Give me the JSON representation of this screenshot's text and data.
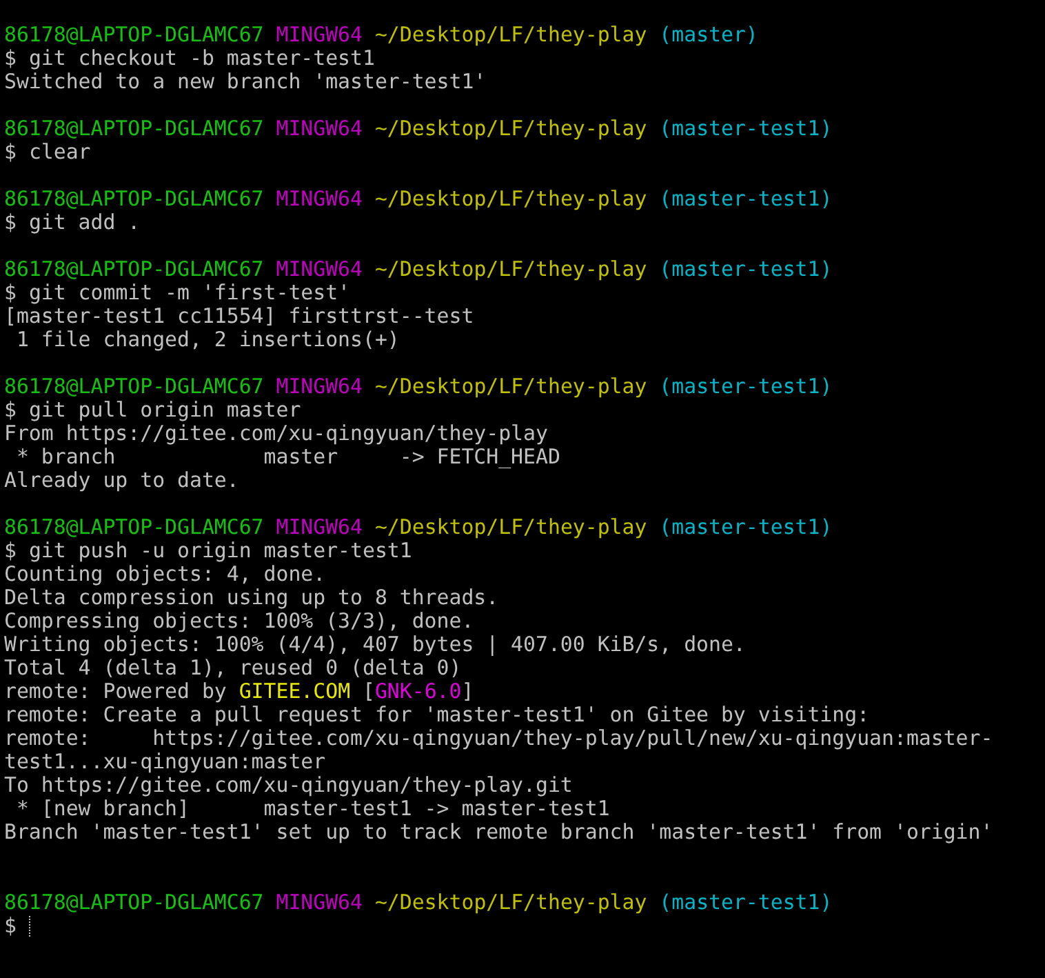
{
  "terminal": {
    "lines": [
      {
        "kind": "prompt",
        "user": "86178@LAPTOP-DGLAMC67",
        "system": "MINGW64",
        "path": "~/Desktop/LF/they-play",
        "branch": "(master)"
      },
      {
        "kind": "command",
        "sign": "$",
        "text": "git checkout -b master-test1"
      },
      {
        "kind": "output",
        "parts": [
          {
            "text": "Switched to a new branch 'master-test1'"
          }
        ]
      },
      {
        "kind": "blank"
      },
      {
        "kind": "prompt",
        "user": "86178@LAPTOP-DGLAMC67",
        "system": "MINGW64",
        "path": "~/Desktop/LF/they-play",
        "branch": "(master-test1)"
      },
      {
        "kind": "command",
        "sign": "$",
        "text": "clear"
      },
      {
        "kind": "blank"
      },
      {
        "kind": "prompt",
        "user": "86178@LAPTOP-DGLAMC67",
        "system": "MINGW64",
        "path": "~/Desktop/LF/they-play",
        "branch": "(master-test1)"
      },
      {
        "kind": "command",
        "sign": "$",
        "text": "git add ."
      },
      {
        "kind": "blank"
      },
      {
        "kind": "prompt",
        "user": "86178@LAPTOP-DGLAMC67",
        "system": "MINGW64",
        "path": "~/Desktop/LF/they-play",
        "branch": "(master-test1)"
      },
      {
        "kind": "command",
        "sign": "$",
        "text": "git commit -m 'first-test'"
      },
      {
        "kind": "output",
        "parts": [
          {
            "text": "[master-test1 cc11554] firsttrst--test"
          }
        ]
      },
      {
        "kind": "output",
        "parts": [
          {
            "text": " 1 file changed, 2 insertions(+)"
          }
        ]
      },
      {
        "kind": "blank"
      },
      {
        "kind": "prompt",
        "user": "86178@LAPTOP-DGLAMC67",
        "system": "MINGW64",
        "path": "~/Desktop/LF/they-play",
        "branch": "(master-test1)"
      },
      {
        "kind": "command",
        "sign": "$",
        "text": "git pull origin master"
      },
      {
        "kind": "output",
        "parts": [
          {
            "text": "From https://gitee.com/xu-qingyuan/they-play"
          }
        ]
      },
      {
        "kind": "output",
        "parts": [
          {
            "text": " * branch            master     -> FETCH_HEAD"
          }
        ]
      },
      {
        "kind": "output",
        "parts": [
          {
            "text": "Already up to date."
          }
        ]
      },
      {
        "kind": "blank"
      },
      {
        "kind": "prompt",
        "user": "86178@LAPTOP-DGLAMC67",
        "system": "MINGW64",
        "path": "~/Desktop/LF/they-play",
        "branch": "(master-test1)"
      },
      {
        "kind": "command",
        "sign": "$",
        "text": "git push -u origin master-test1"
      },
      {
        "kind": "output",
        "parts": [
          {
            "text": "Counting objects: 4, done."
          }
        ]
      },
      {
        "kind": "output",
        "parts": [
          {
            "text": "Delta compression using up to 8 threads."
          }
        ]
      },
      {
        "kind": "output",
        "parts": [
          {
            "text": "Compressing objects: 100% (3/3), done."
          }
        ]
      },
      {
        "kind": "output",
        "parts": [
          {
            "text": "Writing objects: 100% (4/4), 407 bytes | 407.00 KiB/s, done."
          }
        ]
      },
      {
        "kind": "output",
        "parts": [
          {
            "text": "Total 4 (delta 1), reused 0 (delta 0)"
          }
        ]
      },
      {
        "kind": "output",
        "parts": [
          {
            "text": "remote: Powered by "
          },
          {
            "text": "GITEE.COM",
            "color": "#e8e800"
          },
          {
            "text": " ["
          },
          {
            "text": "GNK-6.0",
            "color": "#e000e0"
          },
          {
            "text": "]"
          }
        ]
      },
      {
        "kind": "output",
        "parts": [
          {
            "text": "remote: Create a pull request for 'master-test1' on Gitee by visiting:"
          }
        ]
      },
      {
        "kind": "output",
        "parts": [
          {
            "text": "remote:     https://gitee.com/xu-qingyuan/they-play/pull/new/xu-qingyuan:master-"
          }
        ]
      },
      {
        "kind": "output",
        "parts": [
          {
            "text": "test1...xu-qingyuan:master"
          }
        ]
      },
      {
        "kind": "output",
        "parts": [
          {
            "text": "To https://gitee.com/xu-qingyuan/they-play.git"
          }
        ]
      },
      {
        "kind": "output",
        "parts": [
          {
            "text": " * [new branch]      master-test1 -> master-test1"
          }
        ]
      },
      {
        "kind": "output",
        "parts": [
          {
            "text": "Branch 'master-test1' set up to track remote branch 'master-test1' from 'origin'"
          }
        ]
      },
      {
        "kind": "blank"
      },
      {
        "kind": "blank"
      },
      {
        "kind": "prompt",
        "user": "86178@LAPTOP-DGLAMC67",
        "system": "MINGW64",
        "path": "~/Desktop/LF/they-play",
        "branch": "(master-test1)"
      },
      {
        "kind": "input",
        "sign": "$"
      }
    ]
  }
}
